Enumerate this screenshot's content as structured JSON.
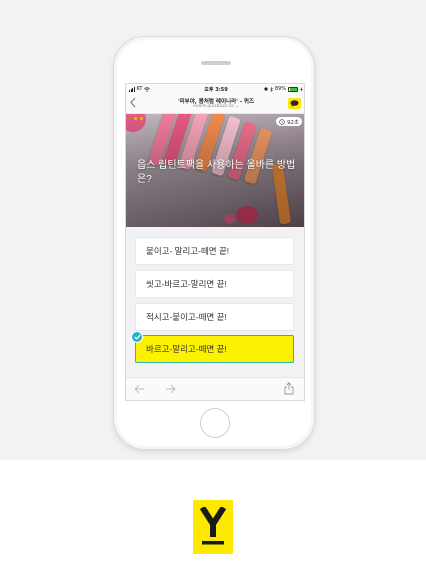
{
  "status_bar": {
    "carrier": "KT",
    "time": "오후 3:59",
    "battery": "89%"
  },
  "browser": {
    "title": "'피부야, 봄처럼 레이니라' - 퀴즈",
    "url": "event.quizbuzz.co ⌄"
  },
  "quiz": {
    "timer": "92초",
    "question": "읍스 립틴트팩을 사용하는 올바른 방법은?",
    "answers": [
      {
        "label": "붙이고- 말리고-떼면 끝!",
        "selected": false
      },
      {
        "label": "씻고-바르고-말리면 끝!",
        "selected": false
      },
      {
        "label": "적시고-붙이고-떼면 끝!",
        "selected": false
      },
      {
        "label": "바르고-말리고-떼면 끝!",
        "selected": true
      }
    ]
  },
  "icons": {
    "back": "chevron-left-icon",
    "kakao": "kakao-talk-icon",
    "nav_back": "arrow-left-icon",
    "nav_forward": "arrow-right-icon",
    "share": "share-icon",
    "check": "check-icon",
    "timer": "clock-icon"
  },
  "colors": {
    "accent_yellow": "#fbf100",
    "kakao_yellow": "#fde800",
    "check_teal": "#27b3c8",
    "brand_logo": "#fde800"
  }
}
